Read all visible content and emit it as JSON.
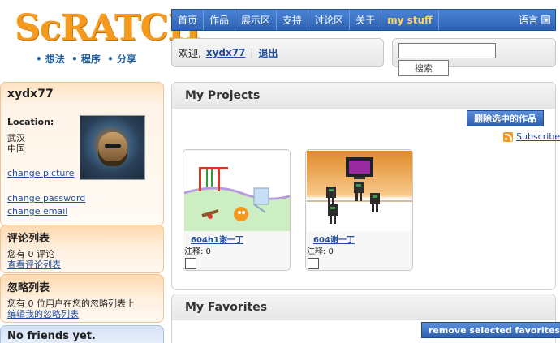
{
  "logo": {
    "text": "ScRATCH",
    "tagline": [
      "• 想法",
      "• 程序",
      "• 分享"
    ]
  },
  "nav": {
    "items": [
      "首页",
      "作品",
      "展示区",
      "支持",
      "讨论区",
      "关于",
      "my stuff"
    ],
    "language_label": "语言"
  },
  "welcome": {
    "greeting": "欢迎,",
    "username": "xydx77",
    "separator": "|",
    "logout": "退出"
  },
  "search": {
    "value": "",
    "button": "搜索"
  },
  "profile": {
    "username": "xydx77",
    "location_label": "Location:",
    "city": "武汉",
    "country": "中国",
    "change_picture": "change picture",
    "change_password": "change password",
    "change_email": "change email"
  },
  "comments": {
    "title": "评论列表",
    "text": "您有 0 评论",
    "link": "查看评论列表"
  },
  "ignore": {
    "title": "忽略列表",
    "text": "您有 0 位用户在您的忽略列表上",
    "link": "编辑我的忽略列表"
  },
  "friends": {
    "title": "No friends yet."
  },
  "projects": {
    "title": "My Projects",
    "delete_button": "删除选中的作品",
    "subscribe": "Subscribe",
    "items": [
      {
        "title": "604h1谢一丁",
        "note": "注释: 0"
      },
      {
        "title": "604谢一丁",
        "note": "注释: 0"
      }
    ]
  },
  "favorites": {
    "title": "My Favorites",
    "remove_button": "remove selected favorites"
  },
  "colors": {
    "nav_blue": "#3a70c4",
    "my_stuff": "#ffd35a",
    "logo_orange": "#f39a1f",
    "link_blue": "#1f4e9c"
  }
}
